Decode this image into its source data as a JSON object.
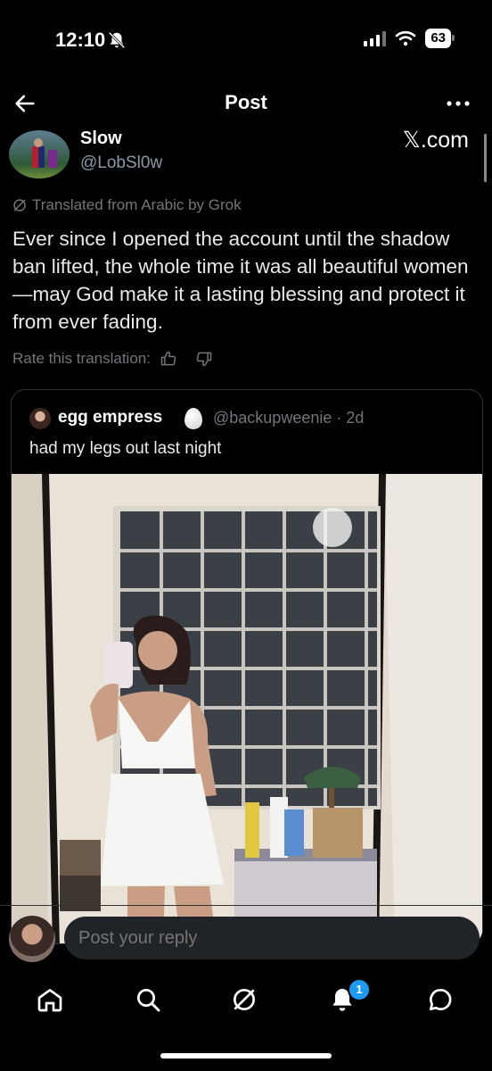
{
  "status_bar": {
    "time": "12:10",
    "battery": "63"
  },
  "header": {
    "title": "Post"
  },
  "post": {
    "author_name": "Slow",
    "author_handle": "@LobSl0w",
    "source_label": "𝕏.com",
    "translated_label": "Translated from Arabic by Grok",
    "text": "Ever since I opened the account until the shadow ban lifted, the whole time it was all beautiful women—may God make it a lasting blessing and protect it from ever fading.",
    "rate_label": "Rate this translation:"
  },
  "quote": {
    "name": "egg empress",
    "handle_meta": "@backupweenie · 2d",
    "text": "had my legs out last night"
  },
  "reply": {
    "placeholder": "Post your reply"
  },
  "nav": {
    "notification_count": "1"
  },
  "colors": {
    "accent": "#1d9bf0",
    "background": "#000000",
    "muted": "#71767b"
  }
}
